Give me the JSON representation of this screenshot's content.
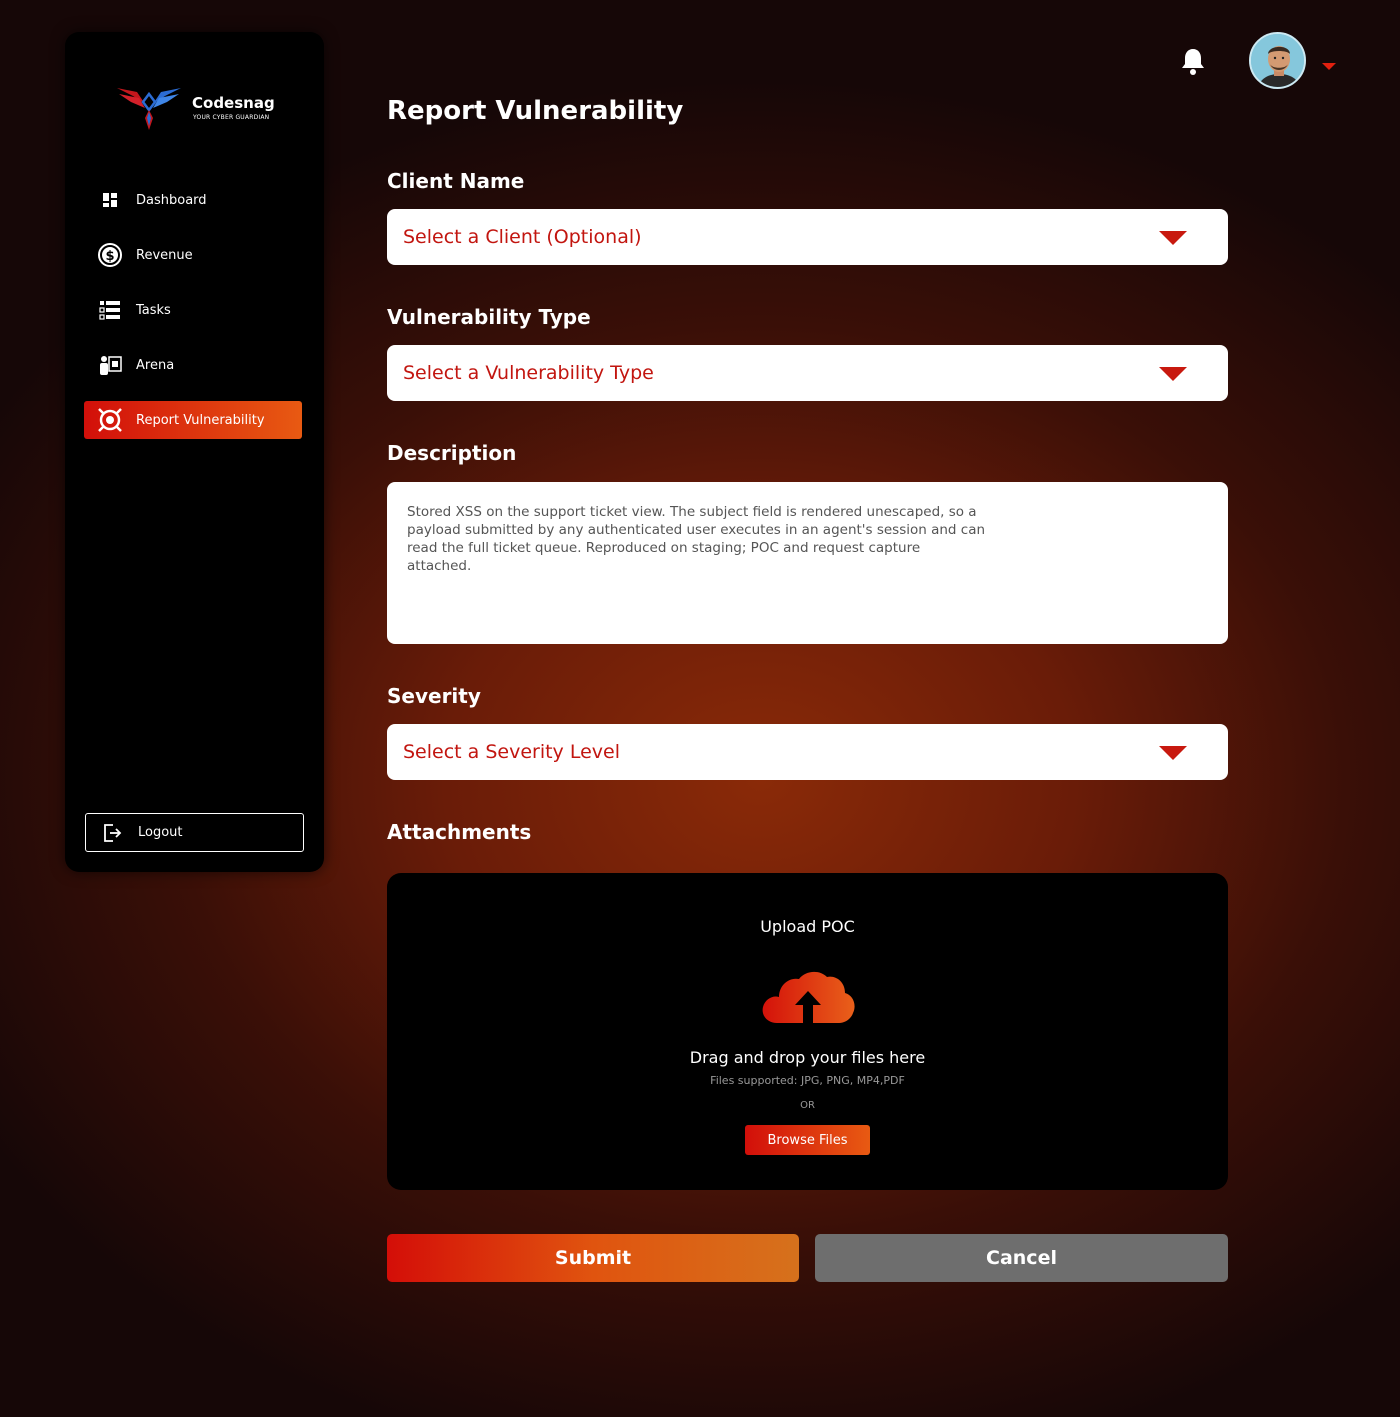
{
  "brand": {
    "name": "Codesnag",
    "tagline": "YOUR CYBER GUARDIAN"
  },
  "sidebar": {
    "items": [
      {
        "label": "Dashboard",
        "icon": "dashboard-icon"
      },
      {
        "label": "Revenue",
        "icon": "dollar-icon"
      },
      {
        "label": "Tasks",
        "icon": "tasks-icon"
      },
      {
        "label": "Arena",
        "icon": "arena-icon"
      },
      {
        "label": "Report Vulnerability",
        "icon": "target-icon",
        "active": true
      }
    ],
    "logout_label": "Logout"
  },
  "header": {
    "notifications_icon": "bell-icon",
    "avatar_caret_icon": "caret-down-icon"
  },
  "page": {
    "title": "Report Vulnerability"
  },
  "form": {
    "client": {
      "label": "Client Name",
      "value": "Select a Client (Optional)"
    },
    "vuln_type": {
      "label": "Vulnerability Type",
      "value": "Select a Vulnerability Type"
    },
    "description": {
      "label": "Description",
      "value": "Stored XSS on the support ticket view. The subject field is rendered unescaped, so a payload submitted by any authenticated user executes in an agent's session and can read the full ticket queue. Reproduced on staging; POC and request capture attached."
    },
    "severity": {
      "label": "Severity",
      "value": "Select a Severity Level"
    },
    "attachments": {
      "label": "Attachments",
      "title": "Upload POC",
      "drag_text": "Drag and drop your files here",
      "supported": "Files supported: JPG, PNG, MP4,PDF",
      "or": "OR",
      "browse_label": "Browse Files"
    }
  },
  "actions": {
    "submit_label": "Submit",
    "cancel_label": "Cancel"
  },
  "colors": {
    "accent": "#d20f0a",
    "accent_end": "#e85a12",
    "cancel_gray": "#6e6e6e",
    "select_text": "#c2150f"
  }
}
